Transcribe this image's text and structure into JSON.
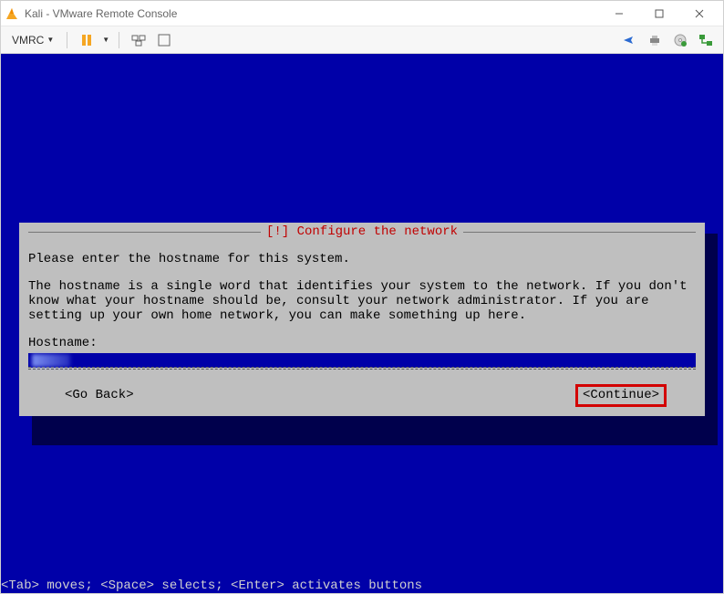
{
  "titlebar": {
    "text": "Kali - VMware Remote Console"
  },
  "toolbar": {
    "menu_label": "VMRC"
  },
  "dialog": {
    "title": "[!] Configure the network",
    "prompt": "Please enter the hostname for this system.",
    "description": "The hostname is a single word that identifies your system to the network. If you don't know what your hostname should be, consult your network administrator. If you are setting up your own home network, you can make something up here.",
    "field_label": "Hostname:",
    "go_back": "<Go Back>",
    "continue": "<Continue>"
  },
  "footer": {
    "hint": "<Tab> moves; <Space> selects; <Enter> activates buttons"
  }
}
